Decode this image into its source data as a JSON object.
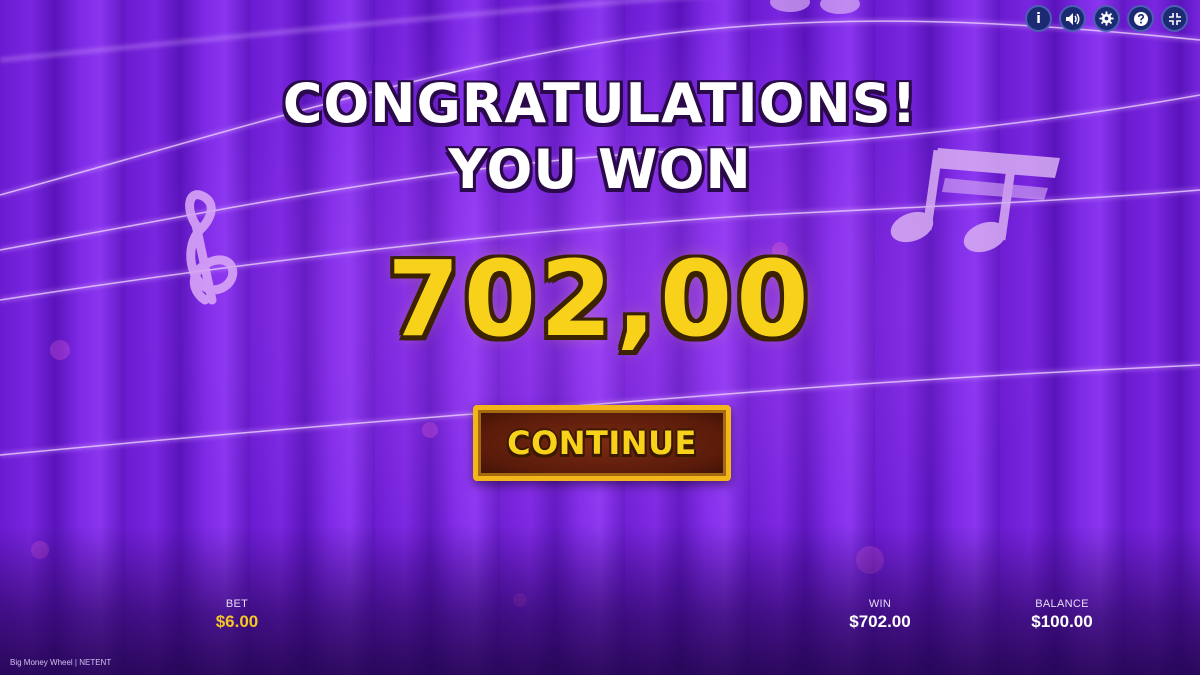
{
  "game": {
    "headline_line1": "CONGRATULATIONS!",
    "headline_line2": "YOU WON",
    "win_amount": "702,00",
    "continue_label": "CONTINUE"
  },
  "toolbar": {
    "info_label": "i",
    "icons": [
      "info-icon",
      "sound-icon",
      "settings-gear-icon",
      "help-icon",
      "minimize-icon"
    ]
  },
  "stats": {
    "bet_label": "BET",
    "bet_value": "$6.00",
    "win_label": "WIN",
    "win_value": "$702.00",
    "balance_label": "BALANCE",
    "balance_value": "$100.00"
  },
  "footer": {
    "brand": "Big Money Wheel | NETENT"
  },
  "colors": {
    "background": "#6a1bd0",
    "gold": "#f8d21a",
    "button_border": "#f2b51a",
    "toolbar_button": "#1b2a72"
  }
}
